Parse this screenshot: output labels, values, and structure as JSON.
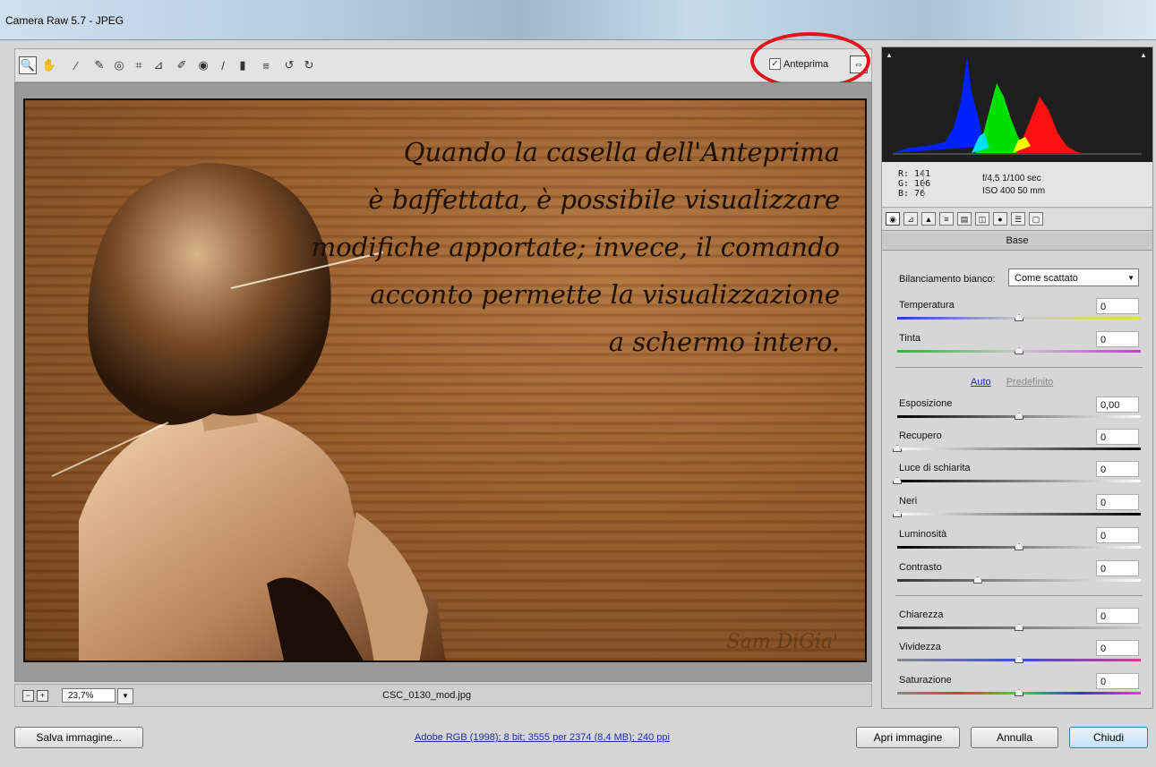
{
  "window": {
    "title": "Camera Raw 5.7  -  JPEG"
  },
  "toolbar": {
    "tools": [
      {
        "name": "zoom-tool-icon",
        "glyph": "🔍"
      },
      {
        "name": "hand-tool-icon",
        "glyph": "✋"
      },
      {
        "name": "white-balance-tool-icon",
        "glyph": "⁄"
      },
      {
        "name": "color-sampler-tool-icon",
        "glyph": "✎"
      },
      {
        "name": "target-adjustment-tool-icon",
        "glyph": "◎"
      },
      {
        "name": "crop-tool-icon",
        "glyph": "⌗"
      },
      {
        "name": "straighten-tool-icon",
        "glyph": "⊿"
      },
      {
        "name": "spot-removal-tool-icon",
        "glyph": "✐"
      },
      {
        "name": "red-eye-tool-icon",
        "glyph": "◉"
      },
      {
        "name": "adjustment-brush-icon",
        "glyph": "/"
      },
      {
        "name": "graduated-filter-icon",
        "glyph": "▮"
      },
      {
        "name": "preferences-icon",
        "glyph": "≡"
      },
      {
        "name": "rotate-left-icon",
        "glyph": "↺"
      },
      {
        "name": "rotate-right-icon",
        "glyph": "↻"
      }
    ],
    "preview_label": "Anteprima",
    "preview_checked": "✓"
  },
  "image": {
    "caption_lines": [
      "Quando la casella dell'Anteprima",
      "è baffettata, è possibile visualizzare",
      "modifiche apportate; invece, il comando",
      "acconto permette la visualizzazione",
      "a schermo intero."
    ],
    "signature": "Sam DiGia'"
  },
  "status": {
    "zoom": "23,7%",
    "filename": "CSC_0130_mod.jpg"
  },
  "readout": {
    "r": "R:  141",
    "g": "G:  106",
    "b": "B:   76",
    "exposure": "f/4,5   1/100 sec",
    "iso": "ISO 400    50 mm"
  },
  "panel": {
    "section_title": "Base",
    "wb_label": "Bilanciamento bianco:",
    "wb_value": "Come scattato",
    "auto": "Auto",
    "default": "Predefinito",
    "sliders": [
      {
        "label": "Temperatura",
        "value": "0",
        "pos": 0.5
      },
      {
        "label": "Tinta",
        "value": "0",
        "pos": 0.5
      },
      {
        "label": "Esposizione",
        "value": "0,00",
        "pos": 0.5
      },
      {
        "label": "Recupero",
        "value": "0",
        "pos": 0.0
      },
      {
        "label": "Luce di schiarita",
        "value": "0",
        "pos": 0.0
      },
      {
        "label": "Neri",
        "value": "0",
        "pos": 0.0
      },
      {
        "label": "Luminosità",
        "value": "0",
        "pos": 0.5
      },
      {
        "label": "Contrasto",
        "value": "0",
        "pos": 0.33
      },
      {
        "label": "Chiarezza",
        "value": "0",
        "pos": 0.5
      },
      {
        "label": "Vividezza",
        "value": "0",
        "pos": 0.5
      },
      {
        "label": "Saturazione",
        "value": "0",
        "pos": 0.5
      }
    ]
  },
  "footer": {
    "save": "Salva immagine...",
    "info": "Adobe RGB (1998); 8 bit; 3555 per 2374 (8,4 MB); 240 ppi",
    "open": "Apri immagine",
    "cancel": "Annulla",
    "done": "Chiudi"
  },
  "colors": {
    "highlight": "#e0151b",
    "link": "#1a2fa8"
  }
}
